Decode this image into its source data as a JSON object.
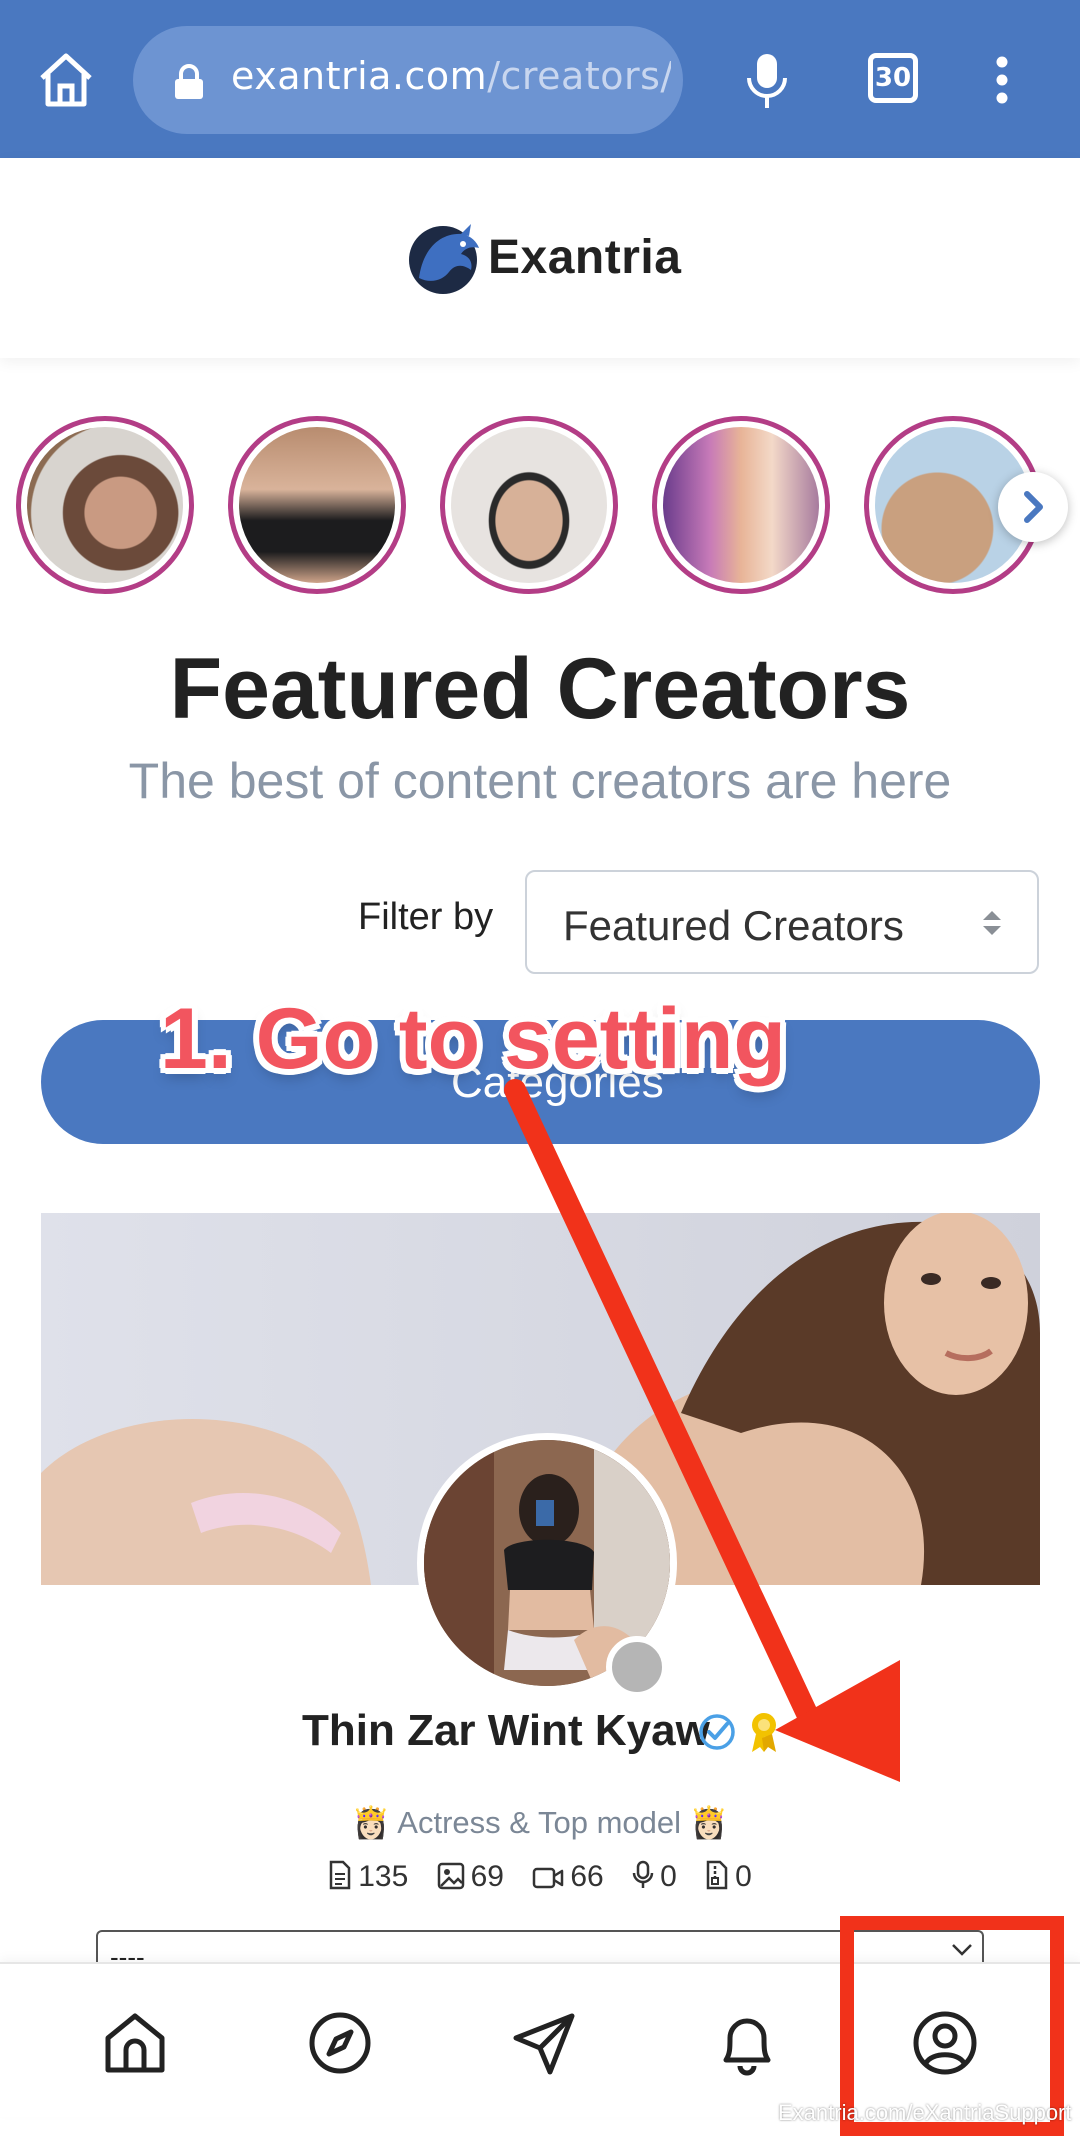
{
  "browser": {
    "url_host": "exantria.com",
    "url_path": "/creators/f",
    "tab_count": "30"
  },
  "site": {
    "logo_text": "Exantria"
  },
  "stories": {
    "items": [
      {
        "name": "story-1"
      },
      {
        "name": "story-2"
      },
      {
        "name": "story-3"
      },
      {
        "name": "story-4"
      },
      {
        "name": "story-5"
      }
    ]
  },
  "heading": {
    "title": "Featured Creators",
    "subtitle": "The best of content creators are here"
  },
  "filter": {
    "label": "Filter by",
    "selected": "Featured Creators"
  },
  "categories": {
    "label": "Categories"
  },
  "annotation": {
    "text": "1. Go to setting",
    "color": "#f1321a"
  },
  "creator": {
    "name": "Thin Zar Wint Kyaw",
    "bio": "👸🏻 Actress & Top model 👸🏻",
    "stats": {
      "posts": "135",
      "photos": "69",
      "videos": "66",
      "audio": "0",
      "files": "0"
    },
    "select_value": "----"
  },
  "watermark": "Exantria.com/eXantriaSupport",
  "colors": {
    "browser_bar": "#4a78c0",
    "accent": "#4a78c0",
    "story_ring": "#b33d86"
  }
}
